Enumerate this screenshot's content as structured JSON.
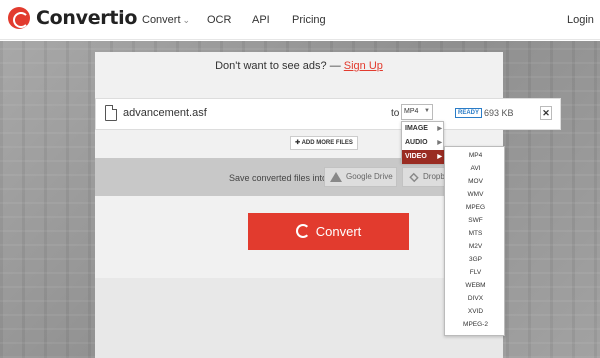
{
  "header": {
    "brand": "Convertio",
    "nav": {
      "convert": "Convert",
      "ocr": "OCR",
      "api": "API",
      "pricing": "Pricing",
      "login": "Login"
    }
  },
  "ad": {
    "text": "Don't want to see ads? —",
    "link": "Sign Up"
  },
  "file": {
    "name": "advancement.asf",
    "to_label": "to",
    "format": "MP4",
    "status": "READY",
    "size": "693 KB",
    "close": "✕"
  },
  "add_more_label": "✚ ADD MORE FILES",
  "save": {
    "text": "Save converted files into my",
    "google_drive": "Google Drive",
    "dropbox": "Dropbox"
  },
  "convert_button": "Convert",
  "categories": [
    {
      "label": "IMAGE",
      "active": false
    },
    {
      "label": "AUDIO",
      "active": false
    },
    {
      "label": "VIDEO",
      "active": true
    }
  ],
  "video_formats": [
    "MP4",
    "AVI",
    "MOV",
    "WMV",
    "MPEG",
    "SWF",
    "MTS",
    "M2V",
    "3GP",
    "FLV",
    "WEBM",
    "DIVX",
    "XVID",
    "MPEG-2"
  ],
  "colors": {
    "brand": "#e23b2e",
    "active_category": "#9a2c22",
    "ready": "#2a7cc7"
  }
}
